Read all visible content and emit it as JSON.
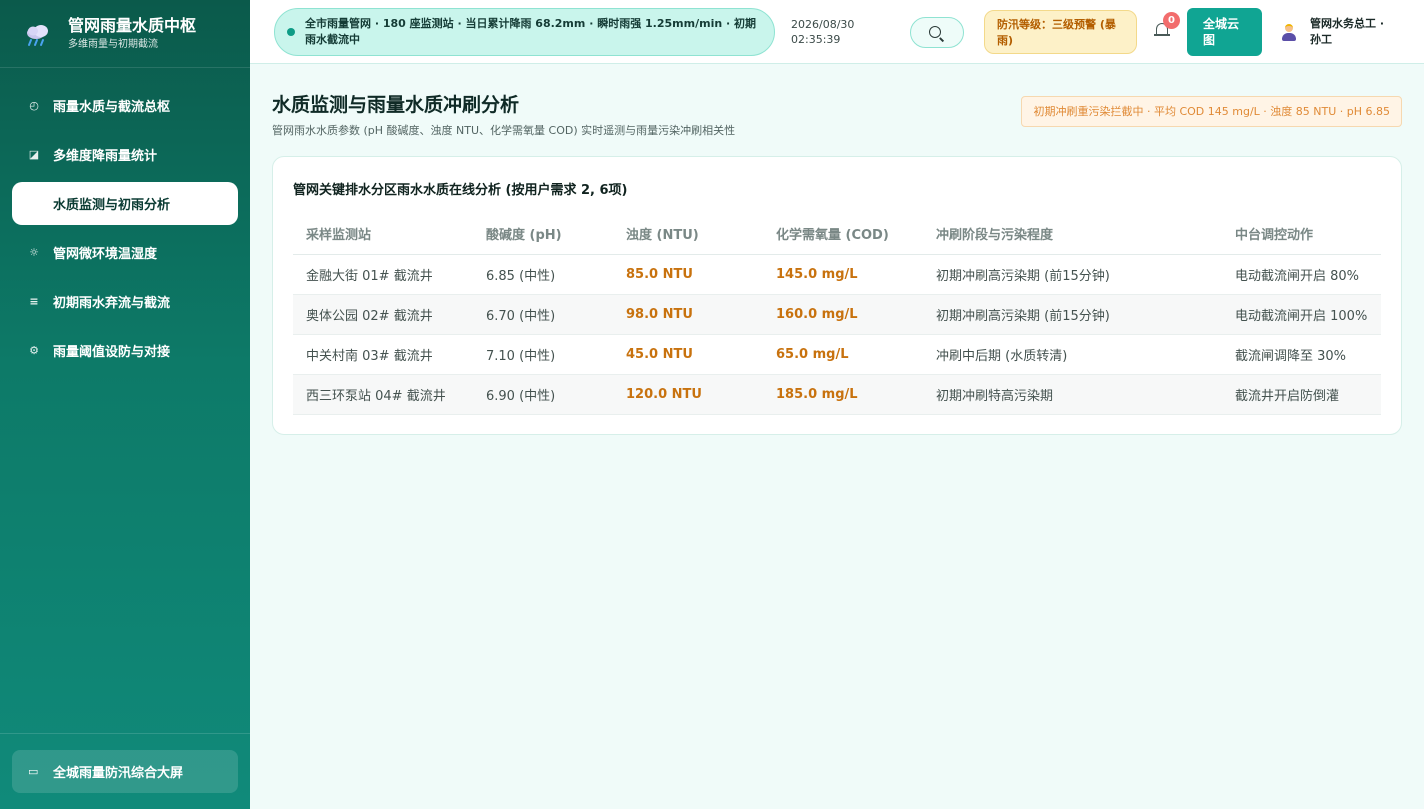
{
  "sidebar": {
    "brand_title": "管网雨量水质中枢",
    "brand_subtitle": "多维雨量与初期截流",
    "items": [
      {
        "label": "雨量水质与截流总枢",
        "icon": "gauge-icon"
      },
      {
        "label": "多维度降雨量统计",
        "icon": "chart-icon"
      },
      {
        "label": "水质监测与初雨分析",
        "icon": "water-icon",
        "active": true
      },
      {
        "label": "管网微环境温湿度",
        "icon": "sun-icon"
      },
      {
        "label": "初期雨水弃流与截流",
        "icon": "sliders-icon"
      },
      {
        "label": "雨量阈值设防与对接",
        "icon": "gear-icon"
      }
    ],
    "bottom_label": "全城雨量防汛综合大屏"
  },
  "header": {
    "ticker": "全市雨量管网 · 180 座监测站 · 当日累计降雨 68.2mm · 瞬时雨强 1.25mm/min · 初期雨水截流中",
    "date": "2026/08/30",
    "time": "02:35:39",
    "alert": "防汛等级：三级预警 (暴雨)",
    "notification_count": "0",
    "cloud_button": "全城云图",
    "user": "管网水务总工 · 孙工"
  },
  "main": {
    "title": "水质监测与雨量水质冲刷分析",
    "subtitle": "管网雨水水质参数 (pH 酸碱度、浊度 NTU、化学需氧量 COD) 实时遥测与雨量污染冲刷相关性",
    "notice": "初期冲刷重污染拦截中 · 平均 COD 145 mg/L · 浊度 85 NTU · pH 6.85",
    "card_title": "管网关键排水分区雨水水质在线分析 (按用户需求 2, 6项)",
    "columns": [
      "采样监测站",
      "酸碱度 (pH)",
      "浊度 (NTU)",
      "化学需氧量 (COD)",
      "冲刷阶段与污染程度",
      "中台调控动作"
    ],
    "rows": [
      [
        "金融大街 01# 截流井",
        "6.85 (中性)",
        "85.0 NTU",
        "145.0 mg/L",
        "初期冲刷高污染期 (前15分钟)",
        "电动截流闸开启 80%"
      ],
      [
        "奥体公园 02# 截流井",
        "6.70 (中性)",
        "98.0 NTU",
        "160.0 mg/L",
        "初期冲刷高污染期 (前15分钟)",
        "电动截流闸开启 100%"
      ],
      [
        "中关村南 03# 截流井",
        "7.10 (中性)",
        "45.0 NTU",
        "65.0 mg/L",
        "冲刷中后期 (水质转清)",
        "截流闸调降至 30%"
      ],
      [
        "西三环泵站 04# 截流井",
        "6.90 (中性)",
        "120.0 NTU",
        "185.0 mg/L",
        "初期冲刷特高污染期",
        "截流井开启防倒灌"
      ]
    ]
  },
  "colors": {
    "accent": "#10a593",
    "highlight": "#c8720e",
    "alert_text": "#b35e00"
  }
}
